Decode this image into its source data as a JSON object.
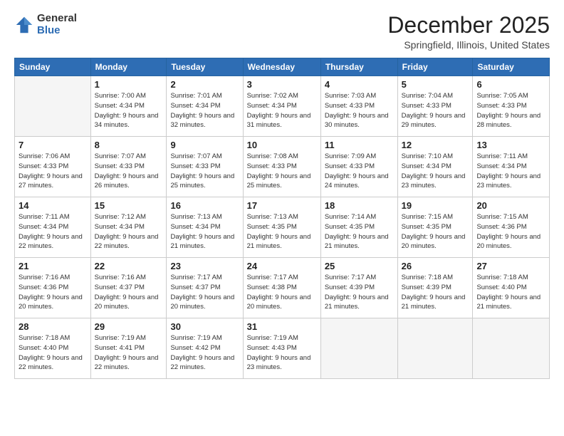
{
  "logo": {
    "general": "General",
    "blue": "Blue"
  },
  "title": "December 2025",
  "subtitle": "Springfield, Illinois, United States",
  "days_header": [
    "Sunday",
    "Monday",
    "Tuesday",
    "Wednesday",
    "Thursday",
    "Friday",
    "Saturday"
  ],
  "weeks": [
    [
      {
        "num": "",
        "empty": true
      },
      {
        "num": "1",
        "rise": "7:00 AM",
        "set": "4:34 PM",
        "daylight": "9 hours and 34 minutes."
      },
      {
        "num": "2",
        "rise": "7:01 AM",
        "set": "4:34 PM",
        "daylight": "9 hours and 32 minutes."
      },
      {
        "num": "3",
        "rise": "7:02 AM",
        "set": "4:34 PM",
        "daylight": "9 hours and 31 minutes."
      },
      {
        "num": "4",
        "rise": "7:03 AM",
        "set": "4:33 PM",
        "daylight": "9 hours and 30 minutes."
      },
      {
        "num": "5",
        "rise": "7:04 AM",
        "set": "4:33 PM",
        "daylight": "9 hours and 29 minutes."
      },
      {
        "num": "6",
        "rise": "7:05 AM",
        "set": "4:33 PM",
        "daylight": "9 hours and 28 minutes."
      }
    ],
    [
      {
        "num": "7",
        "rise": "7:06 AM",
        "set": "4:33 PM",
        "daylight": "9 hours and 27 minutes."
      },
      {
        "num": "8",
        "rise": "7:07 AM",
        "set": "4:33 PM",
        "daylight": "9 hours and 26 minutes."
      },
      {
        "num": "9",
        "rise": "7:07 AM",
        "set": "4:33 PM",
        "daylight": "9 hours and 25 minutes."
      },
      {
        "num": "10",
        "rise": "7:08 AM",
        "set": "4:33 PM",
        "daylight": "9 hours and 25 minutes."
      },
      {
        "num": "11",
        "rise": "7:09 AM",
        "set": "4:33 PM",
        "daylight": "9 hours and 24 minutes."
      },
      {
        "num": "12",
        "rise": "7:10 AM",
        "set": "4:34 PM",
        "daylight": "9 hours and 23 minutes."
      },
      {
        "num": "13",
        "rise": "7:11 AM",
        "set": "4:34 PM",
        "daylight": "9 hours and 23 minutes."
      }
    ],
    [
      {
        "num": "14",
        "rise": "7:11 AM",
        "set": "4:34 PM",
        "daylight": "9 hours and 22 minutes."
      },
      {
        "num": "15",
        "rise": "7:12 AM",
        "set": "4:34 PM",
        "daylight": "9 hours and 22 minutes."
      },
      {
        "num": "16",
        "rise": "7:13 AM",
        "set": "4:34 PM",
        "daylight": "9 hours and 21 minutes."
      },
      {
        "num": "17",
        "rise": "7:13 AM",
        "set": "4:35 PM",
        "daylight": "9 hours and 21 minutes."
      },
      {
        "num": "18",
        "rise": "7:14 AM",
        "set": "4:35 PM",
        "daylight": "9 hours and 21 minutes."
      },
      {
        "num": "19",
        "rise": "7:15 AM",
        "set": "4:35 PM",
        "daylight": "9 hours and 20 minutes."
      },
      {
        "num": "20",
        "rise": "7:15 AM",
        "set": "4:36 PM",
        "daylight": "9 hours and 20 minutes."
      }
    ],
    [
      {
        "num": "21",
        "rise": "7:16 AM",
        "set": "4:36 PM",
        "daylight": "9 hours and 20 minutes."
      },
      {
        "num": "22",
        "rise": "7:16 AM",
        "set": "4:37 PM",
        "daylight": "9 hours and 20 minutes."
      },
      {
        "num": "23",
        "rise": "7:17 AM",
        "set": "4:37 PM",
        "daylight": "9 hours and 20 minutes."
      },
      {
        "num": "24",
        "rise": "7:17 AM",
        "set": "4:38 PM",
        "daylight": "9 hours and 20 minutes."
      },
      {
        "num": "25",
        "rise": "7:17 AM",
        "set": "4:39 PM",
        "daylight": "9 hours and 21 minutes."
      },
      {
        "num": "26",
        "rise": "7:18 AM",
        "set": "4:39 PM",
        "daylight": "9 hours and 21 minutes."
      },
      {
        "num": "27",
        "rise": "7:18 AM",
        "set": "4:40 PM",
        "daylight": "9 hours and 21 minutes."
      }
    ],
    [
      {
        "num": "28",
        "rise": "7:18 AM",
        "set": "4:40 PM",
        "daylight": "9 hours and 22 minutes."
      },
      {
        "num": "29",
        "rise": "7:19 AM",
        "set": "4:41 PM",
        "daylight": "9 hours and 22 minutes."
      },
      {
        "num": "30",
        "rise": "7:19 AM",
        "set": "4:42 PM",
        "daylight": "9 hours and 22 minutes."
      },
      {
        "num": "31",
        "rise": "7:19 AM",
        "set": "4:43 PM",
        "daylight": "9 hours and 23 minutes."
      },
      {
        "num": "",
        "empty": true
      },
      {
        "num": "",
        "empty": true
      },
      {
        "num": "",
        "empty": true
      }
    ]
  ]
}
